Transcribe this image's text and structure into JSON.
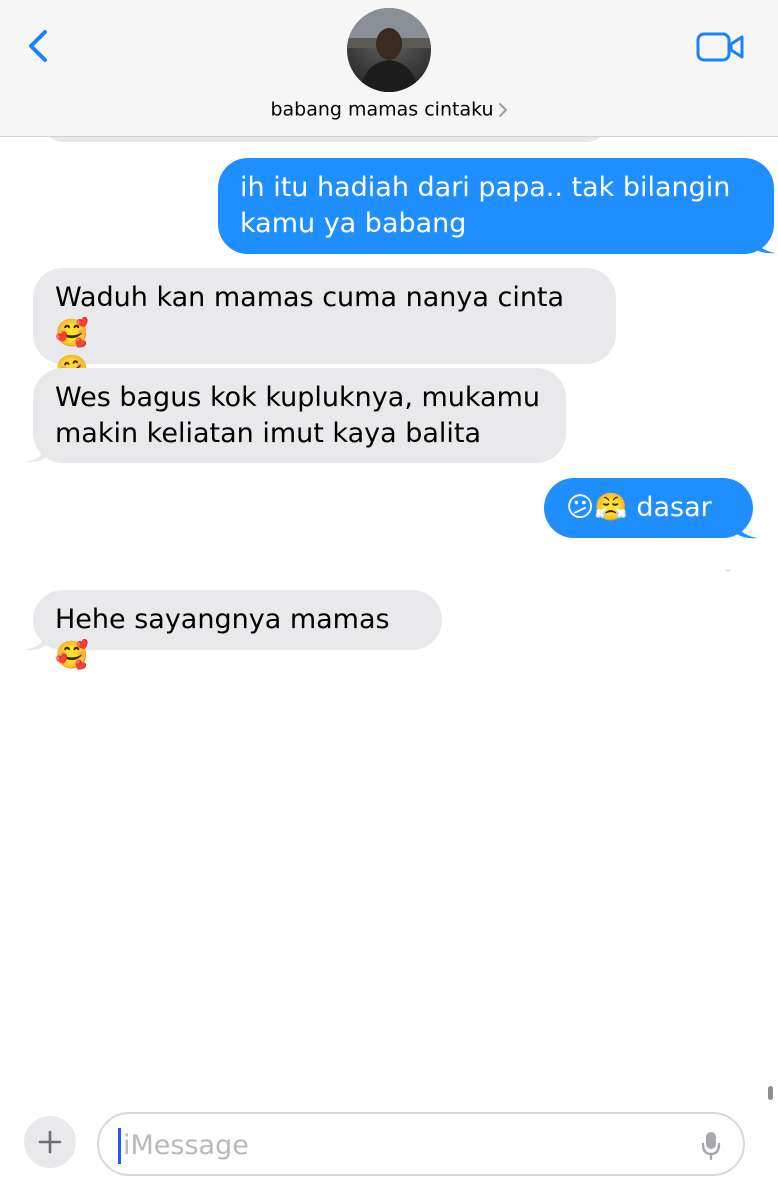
{
  "header": {
    "contact_name": "babang mamas cintaku"
  },
  "messages": [
    {
      "direction": "sent",
      "text_line1": "ih itu hadiah dari papa.. tak bilangin",
      "text_line2": "kamu ya babang"
    },
    {
      "direction": "received",
      "text_line1": "Waduh kan mamas cuma nanya cinta🥰",
      "text_line2": "🤗"
    },
    {
      "direction": "received",
      "text_line1": "Wes bagus kok kupluknya, mukamu",
      "text_line2": "makin keliatan imut kaya balita"
    },
    {
      "direction": "sent",
      "text": "😕😤 dasar"
    },
    {
      "direction": "received",
      "text": "Hehe sayangnya mamas🥰"
    }
  ],
  "composer": {
    "placeholder": "iMessage"
  },
  "colors": {
    "sent_bubble": "#1f8eff",
    "received_bubble": "#e9e9eb",
    "accent": "#1a82fb"
  },
  "icons": [
    "back-chevron-icon",
    "video-camera-icon",
    "chevron-right-icon",
    "plus-icon",
    "microphone-icon"
  ]
}
